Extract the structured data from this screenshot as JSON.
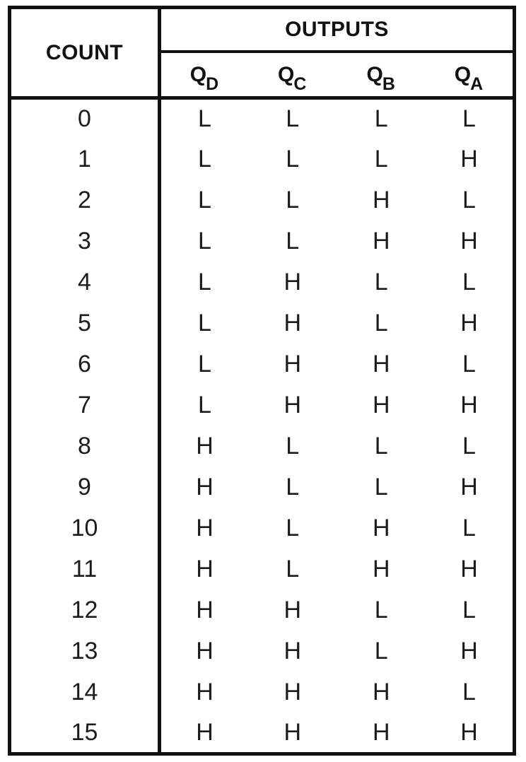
{
  "table": {
    "count_header": "COUNT",
    "outputs_header": "OUTPUTS",
    "output_columns": [
      {
        "base": "Q",
        "sub": "D",
        "label": "QD"
      },
      {
        "base": "Q",
        "sub": "C",
        "label": "QC"
      },
      {
        "base": "Q",
        "sub": "B",
        "label": "QB"
      },
      {
        "base": "Q",
        "sub": "A",
        "label": "QA"
      }
    ],
    "rows": [
      {
        "count": "0",
        "qd": "L",
        "qc": "L",
        "qb": "L",
        "qa": "L"
      },
      {
        "count": "1",
        "qd": "L",
        "qc": "L",
        "qb": "L",
        "qa": "H"
      },
      {
        "count": "2",
        "qd": "L",
        "qc": "L",
        "qb": "H",
        "qa": "L"
      },
      {
        "count": "3",
        "qd": "L",
        "qc": "L",
        "qb": "H",
        "qa": "H"
      },
      {
        "count": "4",
        "qd": "L",
        "qc": "H",
        "qb": "L",
        "qa": "L"
      },
      {
        "count": "5",
        "qd": "L",
        "qc": "H",
        "qb": "L",
        "qa": "H"
      },
      {
        "count": "6",
        "qd": "L",
        "qc": "H",
        "qb": "H",
        "qa": "L"
      },
      {
        "count": "7",
        "qd": "L",
        "qc": "H",
        "qb": "H",
        "qa": "H"
      },
      {
        "count": "8",
        "qd": "H",
        "qc": "L",
        "qb": "L",
        "qa": "L"
      },
      {
        "count": "9",
        "qd": "H",
        "qc": "L",
        "qb": "L",
        "qa": "H"
      },
      {
        "count": "10",
        "qd": "H",
        "qc": "L",
        "qb": "H",
        "qa": "L"
      },
      {
        "count": "11",
        "qd": "H",
        "qc": "L",
        "qb": "H",
        "qa": "H"
      },
      {
        "count": "12",
        "qd": "H",
        "qc": "H",
        "qb": "L",
        "qa": "L"
      },
      {
        "count": "13",
        "qd": "H",
        "qc": "H",
        "qb": "L",
        "qa": "H"
      },
      {
        "count": "14",
        "qd": "H",
        "qc": "H",
        "qb": "H",
        "qa": "L"
      },
      {
        "count": "15",
        "qd": "H",
        "qc": "H",
        "qb": "H",
        "qa": "H"
      }
    ],
    "colors": {
      "border": "#111111",
      "text": "#1a1a1a",
      "background": "#ffffff"
    }
  }
}
